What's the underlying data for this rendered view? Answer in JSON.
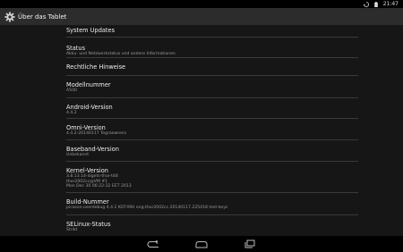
{
  "status_bar": {
    "time": "21:47"
  },
  "action_bar": {
    "title": "Über das Tablet"
  },
  "items": [
    {
      "title": "System Updates",
      "subtitle": ""
    },
    {
      "title": "Status",
      "subtitle": "Akku- und Netzwerkstatus und andere Informationen"
    },
    {
      "title": "Rechtliche Hinweise",
      "subtitle": ""
    },
    {
      "title": "Modellnummer",
      "subtitle": "A500"
    },
    {
      "title": "Android-Version",
      "subtitle": "4.4.2"
    },
    {
      "title": "Omni-Version",
      "subtitle": "4.4.2-20140117 Tegraowners"
    },
    {
      "title": "Baseband-Version",
      "subtitle": "Unbekannt"
    },
    {
      "title": "Kernel-Version",
      "subtitle_lines": [
        "3.8.13.14-digets-thor-t48",
        "thor2002cc@VM #1",
        "Mon Dec 30 06:22:32 EET 2013"
      ]
    },
    {
      "title": "Build-Nummer",
      "subtitle": "picasso-userdebug 4.4.2 KOT49H eng.thor2002cc.20140117.225418 test-keys"
    },
    {
      "title": "SELinux-Status",
      "subtitle": "Strikt"
    }
  ]
}
